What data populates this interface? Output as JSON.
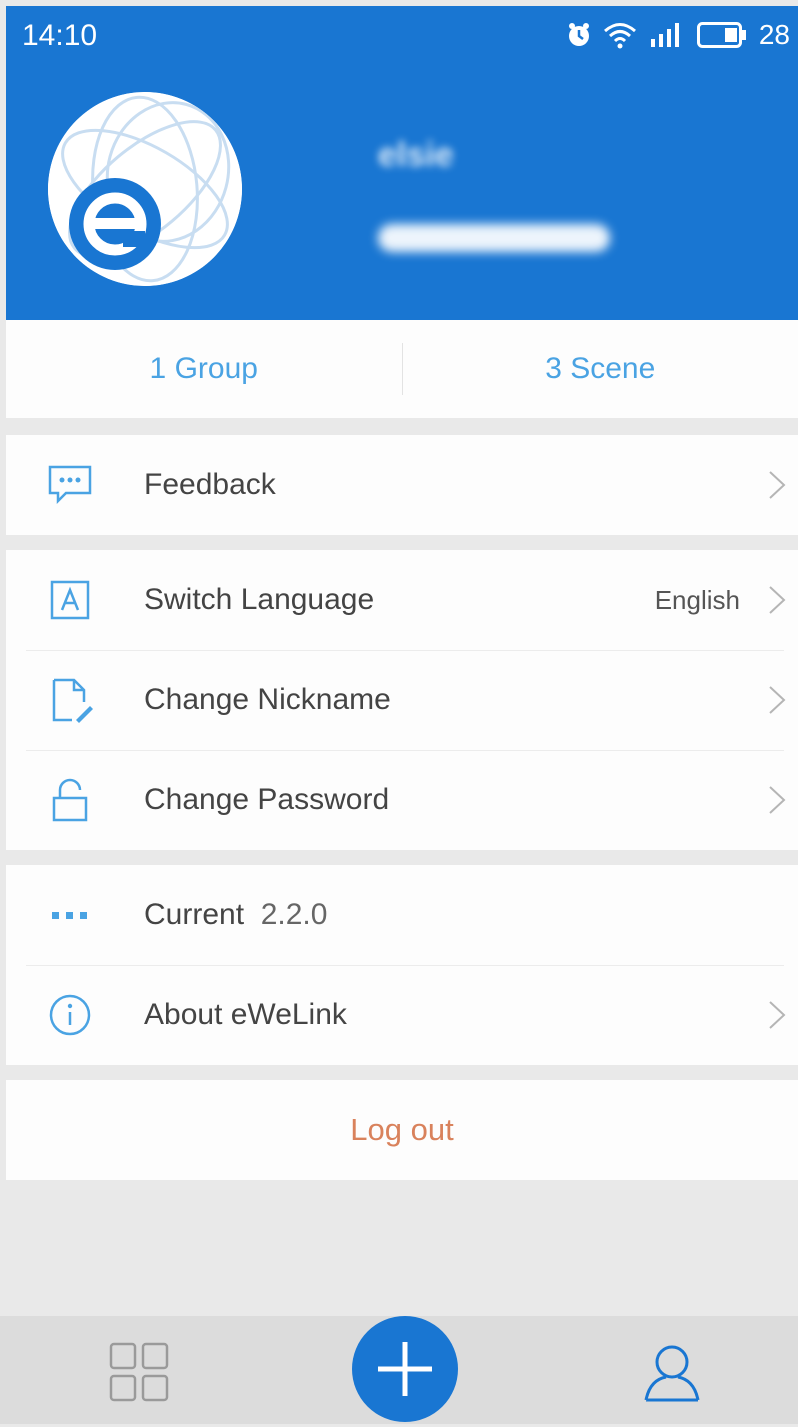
{
  "status_bar": {
    "time": "14:10",
    "battery": "28"
  },
  "profile": {
    "name": "elsie"
  },
  "counts": {
    "group": "1 Group",
    "scene": "3 Scene"
  },
  "menu": {
    "feedback": "Feedback",
    "switch_language": "Switch Language",
    "language_value": "English",
    "change_nickname": "Change Nickname",
    "change_password": "Change Password",
    "current_label": "Current",
    "current_version": "2.2.0",
    "about": "About eWeLink"
  },
  "logout": "Log out",
  "colors": {
    "brand": "#1976d2",
    "link": "#4aa3e3",
    "logout": "#d9825c"
  },
  "icons": {
    "feedback": "chat-bubble-icon",
    "language": "letter-a-icon",
    "nickname": "edit-document-icon",
    "password": "lock-icon",
    "version": "dots-icon",
    "about": "info-icon",
    "grid": "grid-icon",
    "add": "plus-icon",
    "profile": "user-icon"
  }
}
